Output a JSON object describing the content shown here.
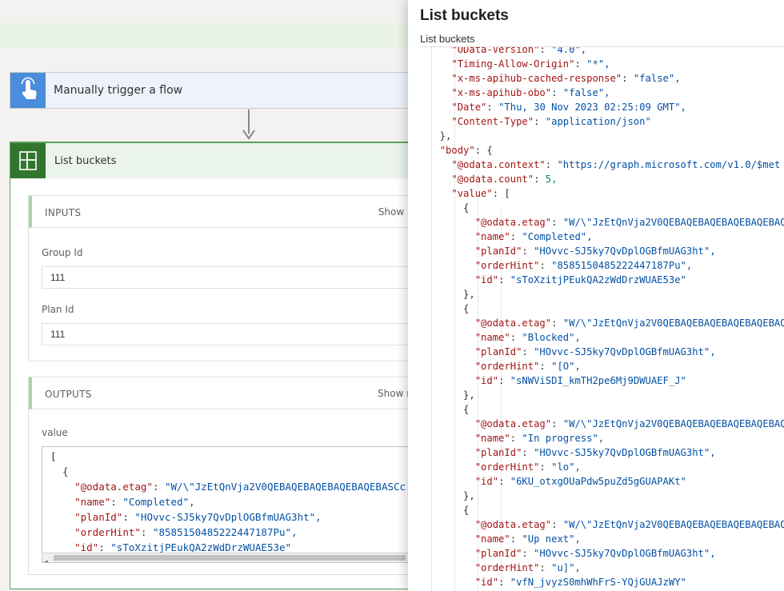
{
  "flow": {
    "trigger": {
      "title": "Manually trigger a flow",
      "icon": "touch-hand-icon"
    },
    "action": {
      "title": "List buckets",
      "icon": "planner-icon",
      "inputs": {
        "title": "INPUTS",
        "show_raw": "Show raw inputs",
        "fields": [
          {
            "label": "Group Id",
            "value": "111"
          },
          {
            "label": "Plan Id",
            "value": "111"
          }
        ]
      },
      "outputs": {
        "title": "OUTPUTS",
        "show_raw": "Show raw outputs",
        "value_label": "value"
      }
    }
  },
  "outputs_code": [
    "[",
    "  {",
    "    \"@odata.etag\": \"W/\\\"JzEtQnVja2V0QEBAQEBAQEBAQEBAQEBASCc",
    "    \"name\": \"Completed\",",
    "    \"planId\": \"HOvvc-SJ5ky7QvDplOGBfmUAG3ht\",",
    "    \"orderHint\": \"8585150485222447187Pu\",",
    "    \"id\": \"sToXzitjPEukQA2zWdDrzWUAE53e\""
  ],
  "panel": {
    "title": "List buckets",
    "subtitle": "List buckets",
    "code": [
      "    \"OData-Version\": \"4.0\",",
      "    \"Timing-Allow-Origin\": \"*\",",
      "    \"x-ms-apihub-cached-response\": \"false\",",
      "    \"x-ms-apihub-obo\": \"false\",",
      "    \"Date\": \"Thu, 30 Nov 2023 02:25:09 GMT\",",
      "    \"Content-Type\": \"application/json\"",
      "  },",
      "  \"body\": {",
      "    \"@odata.context\": \"https://graph.microsoft.com/v1.0/$met",
      "    \"@odata.count\": 5,",
      "    \"value\": [",
      "      {",
      "        \"@odata.etag\": \"W/\\\"JzEtQnVja2V0QEBAQEBAQEBAQEBAQEBAQE",
      "        \"name\": \"Completed\",",
      "        \"planId\": \"HOvvc-SJ5ky7QvDplOGBfmUAG3ht\",",
      "        \"orderHint\": \"8585150485222447187Pu\",",
      "        \"id\": \"sToXzitjPEukQA2zWdDrzWUAE53e\"",
      "      },",
      "      {",
      "        \"@odata.etag\": \"W/\\\"JzEtQnVja2V0QEBAQEBAQEBAQEBAQEBAQE",
      "        \"name\": \"Blocked\",",
      "        \"planId\": \"HOvvc-SJ5ky7QvDplOGBfmUAG3ht\",",
      "        \"orderHint\": \"[O\",",
      "        \"id\": \"sNWViSDI_kmTH2pe6Mj9DWUAEF_J\"",
      "      },",
      "      {",
      "        \"@odata.etag\": \"W/\\\"JzEtQnVja2V0QEBAQEBAQEBAQEBAQEBAQE",
      "        \"name\": \"In progress\",",
      "        \"planId\": \"HOvvc-SJ5ky7QvDplOGBfmUAG3ht\",",
      "        \"orderHint\": \"lo\",",
      "        \"id\": \"6KU_otxgOUaPdw5puZd5gGUAPAKt\"",
      "      },",
      "      {",
      "        \"@odata.etag\": \"W/\\\"JzEtQnVja2V0QEBAQEBAQEBAQEBAQEBAQE",
      "        \"name\": \"Up next\",",
      "        \"planId\": \"HOvvc-SJ5ky7QvDplOGBfmUAG3ht\",",
      "        \"orderHint\": \"u]\",",
      "        \"id\": \"vfN_jvyzS0mhWhFrS-YQjGUAJzWY\""
    ]
  },
  "colors": {
    "trigger_icon": "#4a8ddc",
    "action_icon": "#31752f",
    "action_border": "#5aa05d",
    "json_key": "#a31515",
    "json_string": "#0451a5",
    "json_number": "#098658"
  }
}
